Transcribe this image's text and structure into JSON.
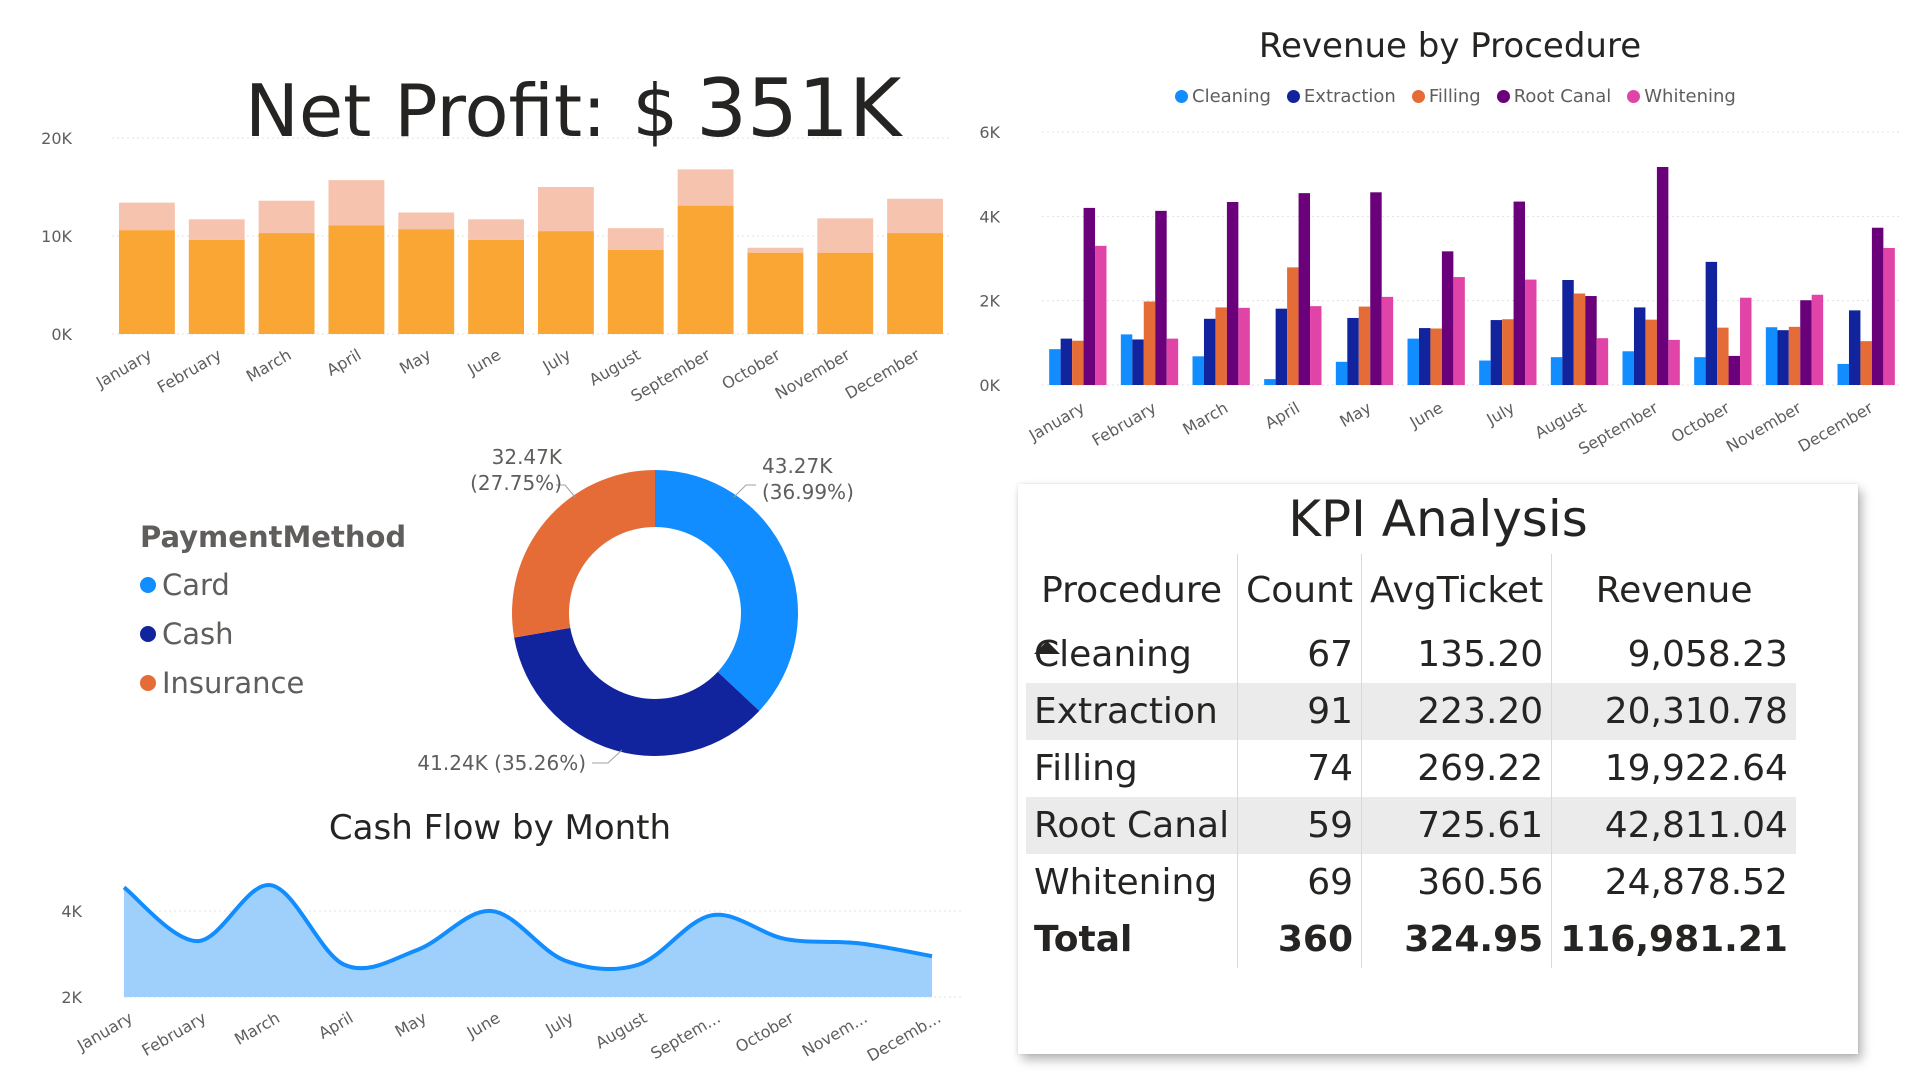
{
  "net_profit": {
    "label": "Net Profit:",
    "currency": "$",
    "value": "351K"
  },
  "colors": {
    "bar_main": "#f9a634",
    "bar_stack": "#f6c3ae",
    "cleaning": "#118dff",
    "extraction": "#12239e",
    "filling": "#e66c37",
    "root_canal": "#6b007b",
    "whitening": "#e044a7",
    "card": "#118dff",
    "cash": "#12239e",
    "insurance": "#e66c37",
    "area_fill": "#9fd0fb",
    "area_line": "#118dff",
    "grid": "#e1e1e1",
    "axis_text": "#605e5c"
  },
  "payment_legend": {
    "title": "PaymentMethod",
    "items": [
      {
        "label": "Card",
        "color": "#118dff"
      },
      {
        "label": "Cash",
        "color": "#12239e"
      },
      {
        "label": "Insurance",
        "color": "#e66c37"
      }
    ]
  },
  "revenue_legend": {
    "items": [
      {
        "label": "Cleaning",
        "color": "#118dff"
      },
      {
        "label": "Extraction",
        "color": "#12239e"
      },
      {
        "label": "Filling",
        "color": "#e66c37"
      },
      {
        "label": "Root Canal",
        "color": "#6b007b"
      },
      {
        "label": "Whitening",
        "color": "#e044a7"
      }
    ]
  },
  "chart_data": [
    {
      "id": "profit_stacked",
      "type": "bar",
      "title": "",
      "categories": [
        "January",
        "February",
        "March",
        "April",
        "May",
        "June",
        "July",
        "August",
        "September",
        "October",
        "November",
        "December"
      ],
      "series": [
        {
          "values": [
            10600,
            9600,
            10300,
            11100,
            10700,
            9600,
            10500,
            8600,
            13100,
            8300,
            8300,
            10300
          ]
        },
        {
          "values": [
            2800,
            2100,
            3300,
            4600,
            1700,
            2100,
            4500,
            2200,
            3700,
            500,
            3500,
            3500
          ]
        }
      ],
      "ylim": [
        0,
        20000
      ],
      "yticks": [
        {
          "v": 0,
          "label": "0K"
        },
        {
          "v": 10000,
          "label": "10K"
        },
        {
          "v": 20000,
          "label": "20K"
        }
      ],
      "grid": true
    },
    {
      "id": "revenue_by_procedure",
      "type": "bar",
      "title": "Revenue by Procedure",
      "categories": [
        "January",
        "February",
        "March",
        "April",
        "May",
        "June",
        "July",
        "August",
        "September",
        "October",
        "November",
        "December"
      ],
      "series": [
        {
          "name": "Cleaning",
          "values": [
            850,
            1200,
            680,
            140,
            550,
            1100,
            580,
            660,
            800,
            660,
            1370,
            500
          ]
        },
        {
          "name": "Extraction",
          "values": [
            1100,
            1080,
            1570,
            1810,
            1590,
            1350,
            1540,
            2490,
            1840,
            2920,
            1300,
            1770
          ]
        },
        {
          "name": "Filling",
          "values": [
            1050,
            1980,
            1840,
            2790,
            1860,
            1340,
            1560,
            2170,
            1550,
            1360,
            1380,
            1040
          ]
        },
        {
          "name": "Root Canal",
          "values": [
            4200,
            4130,
            4340,
            4550,
            4570,
            3170,
            4350,
            2110,
            5170,
            690,
            2010,
            3730
          ]
        },
        {
          "name": "Whitening",
          "values": [
            3300,
            1100,
            1830,
            1870,
            2090,
            2560,
            2500,
            1110,
            1070,
            2070,
            2140,
            3250
          ]
        }
      ],
      "ylim": [
        0,
        6000
      ],
      "yticks": [
        {
          "v": 0,
          "label": "0K"
        },
        {
          "v": 2000,
          "label": "2K"
        },
        {
          "v": 4000,
          "label": "4K"
        },
        {
          "v": 6000,
          "label": "6K"
        }
      ],
      "legend": "top-center",
      "grid": true
    },
    {
      "id": "payment_donut",
      "type": "pie",
      "labels": [
        "Card",
        "Cash",
        "Insurance"
      ],
      "values": [
        43270,
        41240,
        32470
      ],
      "data_labels": [
        [
          "43.27K",
          "(36.99%)"
        ],
        [
          "41.24K (35.26%)"
        ],
        [
          "32.47K",
          "(27.75%)"
        ]
      ]
    },
    {
      "id": "cash_flow",
      "type": "area",
      "title": "Cash Flow by Month",
      "categories": [
        "January",
        "February",
        "March",
        "April",
        "May",
        "June",
        "July",
        "August",
        "Septem...",
        "October",
        "Novem...",
        "Decemb..."
      ],
      "values": [
        4550,
        3300,
        4600,
        2750,
        3100,
        4000,
        2850,
        2750,
        3900,
        3350,
        3250,
        2950
      ],
      "ylim": [
        2000,
        5000
      ],
      "yticks": [
        {
          "v": 2000,
          "label": "2K"
        },
        {
          "v": 4000,
          "label": "4K"
        }
      ],
      "grid": true
    }
  ],
  "kpi": {
    "title": "KPI Analysis",
    "headers": {
      "procedure": "Procedure",
      "count": "Count",
      "avg": "AvgTicket",
      "revenue": "Revenue"
    },
    "rows": [
      {
        "procedure": "Cleaning",
        "count": "67",
        "avg": "135.20",
        "revenue": "9,058.23"
      },
      {
        "procedure": "Extraction",
        "count": "91",
        "avg": "223.20",
        "revenue": "20,310.78"
      },
      {
        "procedure": "Filling",
        "count": "74",
        "avg": "269.22",
        "revenue": "19,922.64"
      },
      {
        "procedure": "Root Canal",
        "count": "59",
        "avg": "725.61",
        "revenue": "42,811.04"
      },
      {
        "procedure": "Whitening",
        "count": "69",
        "avg": "360.56",
        "revenue": "24,878.52"
      }
    ],
    "total": {
      "procedure": "Total",
      "count": "360",
      "avg": "324.95",
      "revenue": "116,981.21"
    }
  }
}
